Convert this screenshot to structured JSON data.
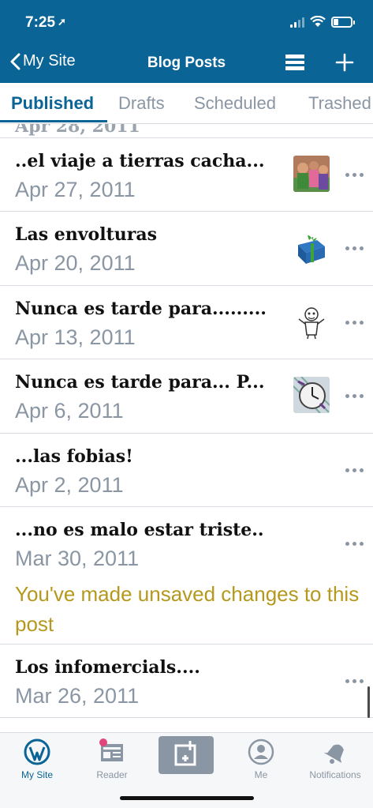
{
  "status_bar": {
    "time": "7:25",
    "location_icon": "location-arrow-icon",
    "battery_level": 0.3
  },
  "nav": {
    "back_label": "My Site",
    "title": "Blog Posts",
    "menu_icon": "list-layout-icon",
    "add_icon": "plus-icon"
  },
  "tabs": [
    {
      "label": "Published",
      "active": true
    },
    {
      "label": "Drafts",
      "active": false
    },
    {
      "label": "Scheduled",
      "active": false
    },
    {
      "label": "Trashed",
      "active": false
    }
  ],
  "posts": [
    {
      "title": "..el viaje a tierras cacha...",
      "date": "Apr 27, 2011",
      "thumbnail": "people-photo"
    },
    {
      "title": "Las envolturas",
      "date": "Apr 20, 2011",
      "thumbnail": "gift-box-image"
    },
    {
      "title": "Nunca es tarde para.........",
      "date": "Apr 13, 2011",
      "thumbnail": "cartoon-sketch-image"
    },
    {
      "title": "Nunca es tarde para...   P...",
      "date": "Apr 6, 2011",
      "thumbnail": "clock-image"
    },
    {
      "title": "...las fobias!",
      "date": "Apr 2, 2011",
      "thumbnail": ""
    },
    {
      "title": "...no es malo estar triste..",
      "date": "Mar 30, 2011",
      "thumbnail": "",
      "warning": "You've made unsaved changes to this post"
    },
    {
      "title": "Los infomercials....",
      "date": "Mar 26, 2011",
      "thumbnail": ""
    }
  ],
  "tabbar": [
    {
      "label": "My Site",
      "icon": "wordpress-icon",
      "active": true
    },
    {
      "label": "Reader",
      "icon": "reader-icon",
      "active": false
    },
    {
      "label": "",
      "icon": "compose-icon",
      "active": false
    },
    {
      "label": "Me",
      "icon": "person-icon",
      "active": false
    },
    {
      "label": "Notifications",
      "icon": "bell-icon",
      "active": false
    }
  ],
  "colors": {
    "brand": "#0a6496",
    "muted": "#8a96a3",
    "warning": "#b5981e",
    "badge": "#e0457b"
  }
}
